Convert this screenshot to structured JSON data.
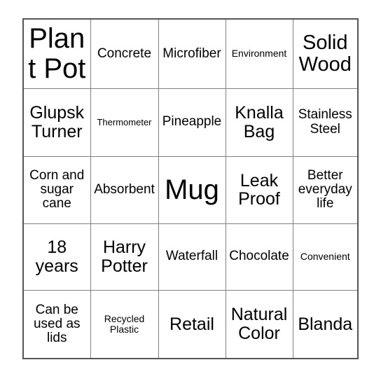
{
  "card": {
    "type": "bingo-card",
    "rows": 5,
    "columns": 5,
    "border_color": "#555555",
    "grid_line_color": "#808080",
    "background_color": "#ffffff",
    "text_color": "#000000",
    "cells": [
      [
        {
          "text": "Plant Pot",
          "size": "xl"
        },
        {
          "text": "Concrete",
          "size": "sm"
        },
        {
          "text": "Microfiber",
          "size": "sm"
        },
        {
          "text": "Environment",
          "size": "xs"
        },
        {
          "text": "Solid Wood",
          "size": "lg"
        }
      ],
      [
        {
          "text": "Glupsk Turner",
          "size": "md"
        },
        {
          "text": "Thermometer",
          "size": "xxs"
        },
        {
          "text": "Pineapple",
          "size": "sm"
        },
        {
          "text": "Knalla Bag",
          "size": "md"
        },
        {
          "text": "Stainless Steel",
          "size": "sm"
        }
      ],
      [
        {
          "text": "Corn and sugar cane",
          "size": "sm"
        },
        {
          "text": "Absorbent",
          "size": "sm"
        },
        {
          "text": "Mug",
          "size": "xl"
        },
        {
          "text": "Leak Proof",
          "size": "md"
        },
        {
          "text": "Better everyday life",
          "size": "sm"
        }
      ],
      [
        {
          "text": "18 years",
          "size": "md"
        },
        {
          "text": "Harry Potter",
          "size": "md"
        },
        {
          "text": "Waterfall",
          "size": "sm"
        },
        {
          "text": "Chocolate",
          "size": "sm"
        },
        {
          "text": "Convenient",
          "size": "xs"
        }
      ],
      [
        {
          "text": "Can be used as lids",
          "size": "sm"
        },
        {
          "text": "Recycled Plastic",
          "size": "xs"
        },
        {
          "text": "Retail",
          "size": "md"
        },
        {
          "text": "Natural Color",
          "size": "md"
        },
        {
          "text": "Blanda",
          "size": "md"
        }
      ]
    ]
  }
}
